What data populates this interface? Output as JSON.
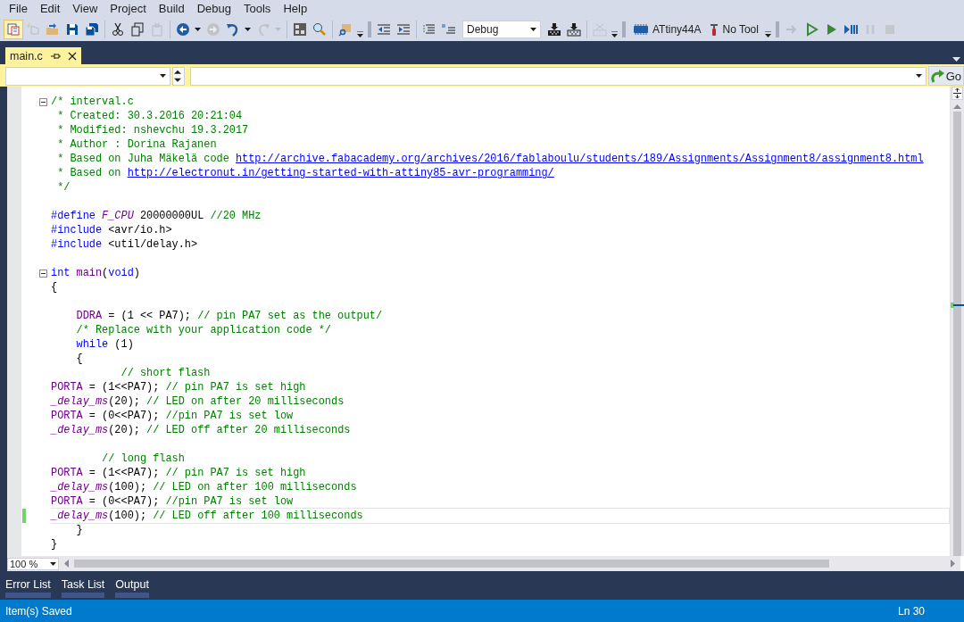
{
  "menu": [
    "File",
    "Edit",
    "View",
    "Project",
    "Build",
    "Debug",
    "Tools",
    "Help"
  ],
  "toolbar": [
    {
      "kind": "button",
      "active": true,
      "disabled": false
    },
    {
      "kind": "button",
      "active": false,
      "disabled": true
    },
    {
      "kind": "button",
      "active": false,
      "disabled": false
    },
    {
      "kind": "button",
      "active": false,
      "disabled": false
    },
    {
      "kind": "button",
      "active": false,
      "disabled": false
    },
    {
      "kind": "separator"
    },
    {
      "kind": "button",
      "active": false,
      "disabled": false
    },
    {
      "kind": "button",
      "active": false,
      "disabled": false
    },
    {
      "kind": "button",
      "active": false,
      "disabled": true
    },
    {
      "kind": "separator"
    },
    {
      "kind": "split",
      "active": false,
      "disabled": false
    },
    {
      "kind": "button",
      "active": false,
      "disabled": true
    },
    {
      "kind": "split",
      "active": false,
      "disabled": false
    },
    {
      "kind": "split",
      "active": false,
      "disabled": true
    },
    {
      "kind": "separator"
    },
    {
      "kind": "button",
      "active": false,
      "disabled": false
    },
    {
      "kind": "button",
      "active": false,
      "disabled": false
    },
    {
      "kind": "separator"
    },
    {
      "kind": "button",
      "active": false,
      "disabled": false
    },
    {
      "kind": "overflow"
    },
    {
      "kind": "grip"
    },
    {
      "kind": "button",
      "active": false,
      "disabled": false
    },
    {
      "kind": "button",
      "active": false,
      "disabled": false
    },
    {
      "kind": "separator"
    },
    {
      "kind": "button",
      "active": false,
      "disabled": false
    },
    {
      "kind": "button",
      "active": false,
      "disabled": false
    },
    {
      "kind": "combo",
      "value": "Debug"
    },
    {
      "kind": "button",
      "active": false,
      "disabled": false
    },
    {
      "kind": "button",
      "active": false,
      "disabled": false
    },
    {
      "kind": "separator"
    },
    {
      "kind": "button",
      "active": false,
      "disabled": true
    },
    {
      "kind": "overflow"
    },
    {
      "kind": "grip"
    },
    {
      "kind": "labeled",
      "label": "ATtiny44A"
    },
    {
      "kind": "labeled",
      "label": "No Tool"
    },
    {
      "kind": "overflow"
    },
    {
      "kind": "grip"
    },
    {
      "kind": "button",
      "active": false,
      "disabled": true
    },
    {
      "kind": "button",
      "active": false,
      "disabled": false
    },
    {
      "kind": "button",
      "active": false,
      "disabled": false
    },
    {
      "kind": "button",
      "active": false,
      "disabled": false
    },
    {
      "kind": "button",
      "active": false,
      "disabled": true
    },
    {
      "kind": "button",
      "active": false,
      "disabled": true
    }
  ],
  "tabs": [
    {
      "label": "main.c",
      "selected": true
    }
  ],
  "navigation": {
    "go_label": "Go"
  },
  "editor": {
    "lines": [
      {
        "fold": true,
        "current": false,
        "changed": false,
        "tokens": [
          {
            "kind": "comment",
            "text": "/* interval.c"
          }
        ]
      },
      {
        "fold": false,
        "current": false,
        "changed": false,
        "tokens": [
          {
            "kind": "comment",
            "text": " * Created: 30.3.2016 20:21:04"
          }
        ]
      },
      {
        "fold": false,
        "current": false,
        "changed": false,
        "tokens": [
          {
            "kind": "comment",
            "text": " * Modified: nshevchu 19.3.2017"
          }
        ]
      },
      {
        "fold": false,
        "current": false,
        "changed": false,
        "tokens": [
          {
            "kind": "comment",
            "text": " * Author : Dorina Rajanen"
          }
        ]
      },
      {
        "fold": false,
        "current": false,
        "changed": false,
        "tokens": [
          {
            "kind": "comment",
            "text": " * Based on Juha Mäkelä code "
          },
          {
            "kind": "link",
            "text": "http://archive.fabacademy.org/archives/2016/fablaboulu/students/189/Assignments/Assignment8/assignment8.html"
          }
        ]
      },
      {
        "fold": false,
        "current": false,
        "changed": false,
        "tokens": [
          {
            "kind": "comment",
            "text": " * Based on "
          },
          {
            "kind": "link",
            "text": "http://electronut.in/getting-started-with-attiny85-avr-programming/"
          }
        ]
      },
      {
        "fold": false,
        "current": false,
        "changed": false,
        "tokens": [
          {
            "kind": "comment",
            "text": " */"
          }
        ]
      },
      {
        "fold": false,
        "current": false,
        "changed": false
      },
      {
        "fold": false,
        "current": false,
        "changed": false,
        "tokens": [
          {
            "kind": "keyword",
            "text": "#define"
          },
          {
            "kind": "macro",
            "text": " F_CPU"
          },
          {
            "kind": "plain",
            "text": " 20000000UL "
          },
          {
            "kind": "comment",
            "text": "//20 MHz"
          }
        ]
      },
      {
        "fold": false,
        "current": false,
        "changed": false,
        "tokens": [
          {
            "kind": "keyword",
            "text": "#include"
          },
          {
            "kind": "plain",
            "text": " <avr/io.h>"
          }
        ]
      },
      {
        "fold": false,
        "current": false,
        "changed": false,
        "tokens": [
          {
            "kind": "keyword",
            "text": "#include"
          },
          {
            "kind": "plain",
            "text": " <util/delay.h>"
          }
        ]
      },
      {
        "fold": false,
        "current": false,
        "changed": false
      },
      {
        "fold": true,
        "current": false,
        "changed": false,
        "tokens": [
          {
            "kind": "keyword",
            "text": "int"
          },
          {
            "kind": "ident",
            "text": " main"
          },
          {
            "kind": "plain",
            "text": "("
          },
          {
            "kind": "keyword",
            "text": "void"
          },
          {
            "kind": "plain",
            "text": ")"
          }
        ]
      },
      {
        "fold": false,
        "current": false,
        "changed": false,
        "tokens": [
          {
            "kind": "plain",
            "text": "{"
          }
        ]
      },
      {
        "fold": false,
        "current": false,
        "changed": false
      },
      {
        "fold": false,
        "current": false,
        "changed": false,
        "tokens": [
          {
            "kind": "ident",
            "text": "    DDRA"
          },
          {
            "kind": "plain",
            "text": " = (1 << PA7); "
          },
          {
            "kind": "comment",
            "text": "// pin PA7 set as the output/"
          }
        ]
      },
      {
        "fold": false,
        "current": false,
        "changed": false,
        "tokens": [
          {
            "kind": "comment",
            "text": "    /* Replace with your application code */"
          }
        ]
      },
      {
        "fold": false,
        "current": false,
        "changed": false,
        "tokens": [
          {
            "kind": "keyword",
            "text": "    while"
          },
          {
            "kind": "plain",
            "text": " (1)"
          }
        ]
      },
      {
        "fold": false,
        "current": false,
        "changed": false,
        "tokens": [
          {
            "kind": "plain",
            "text": "    {"
          }
        ]
      },
      {
        "fold": false,
        "current": false,
        "changed": false,
        "tokens": [
          {
            "kind": "comment",
            "text": "           // short flash"
          }
        ]
      },
      {
        "fold": false,
        "current": false,
        "changed": false,
        "tokens": [
          {
            "kind": "ident",
            "text": "PORTA"
          },
          {
            "kind": "plain",
            "text": " = (1<<PA7); "
          },
          {
            "kind": "comment",
            "text": "// pin PA7 is set high"
          }
        ]
      },
      {
        "fold": false,
        "current": false,
        "changed": false,
        "tokens": [
          {
            "kind": "macro",
            "text": "_delay_ms"
          },
          {
            "kind": "plain",
            "text": "(20); "
          },
          {
            "kind": "comment",
            "text": "// LED on after 20 milliseconds"
          }
        ]
      },
      {
        "fold": false,
        "current": false,
        "changed": false,
        "tokens": [
          {
            "kind": "ident",
            "text": "PORTA"
          },
          {
            "kind": "plain",
            "text": " = (0<<PA7); "
          },
          {
            "kind": "comment",
            "text": "//pin PA7 is set low"
          }
        ]
      },
      {
        "fold": false,
        "current": false,
        "changed": false,
        "tokens": [
          {
            "kind": "macro",
            "text": "_delay_ms"
          },
          {
            "kind": "plain",
            "text": "(20); "
          },
          {
            "kind": "comment",
            "text": "// LED off after 20 milliseconds"
          }
        ]
      },
      {
        "fold": false,
        "current": false,
        "changed": false
      },
      {
        "fold": false,
        "current": false,
        "changed": false,
        "tokens": [
          {
            "kind": "comment",
            "text": "        // long flash"
          }
        ]
      },
      {
        "fold": false,
        "current": false,
        "changed": false,
        "tokens": [
          {
            "kind": "ident",
            "text": "PORTA"
          },
          {
            "kind": "plain",
            "text": " = (1<<PA7); "
          },
          {
            "kind": "comment",
            "text": "// pin PA7 is set high"
          }
        ]
      },
      {
        "fold": false,
        "current": false,
        "changed": false,
        "tokens": [
          {
            "kind": "macro",
            "text": "_delay_ms"
          },
          {
            "kind": "plain",
            "text": "(100); "
          },
          {
            "kind": "comment",
            "text": "// LED on after 100 milliseconds"
          }
        ]
      },
      {
        "fold": false,
        "current": false,
        "changed": false,
        "tokens": [
          {
            "kind": "ident",
            "text": "PORTA"
          },
          {
            "kind": "plain",
            "text": " = (0<<PA7); "
          },
          {
            "kind": "comment",
            "text": "//pin PA7 is set low"
          }
        ]
      },
      {
        "fold": false,
        "current": true,
        "changed": true,
        "tokens": [
          {
            "kind": "macro",
            "text": "_delay_ms"
          },
          {
            "kind": "plain",
            "text": "(100); "
          },
          {
            "kind": "comment",
            "text": "// LED off after 100 milliseconds"
          }
        ]
      },
      {
        "fold": false,
        "current": false,
        "changed": false,
        "tokens": [
          {
            "kind": "plain",
            "text": "    }"
          }
        ]
      },
      {
        "fold": false,
        "current": false,
        "changed": false,
        "tokens": [
          {
            "kind": "plain",
            "text": "}"
          }
        ]
      }
    ],
    "zoom": "100 %"
  },
  "bottom_tabs": [
    "Error List",
    "Task List",
    "Output"
  ],
  "status_bar": {
    "message": "Item(s) Saved",
    "line": "Ln 30"
  }
}
